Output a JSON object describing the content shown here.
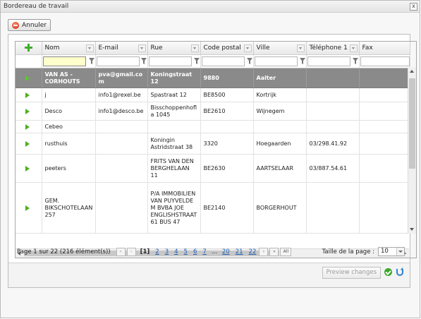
{
  "window": {
    "title": "Bordereau de travail",
    "close": "x"
  },
  "toolbar": {
    "cancel_label": "Annuler"
  },
  "grid": {
    "columns": [
      "Nom",
      "E-mail",
      "Rue",
      "Code postal",
      "Ville",
      "Téléphone 1",
      "Fax"
    ],
    "rows": [
      {
        "nom": "VAN AS - CORHOUTS",
        "email": "pva@gmail.com",
        "rue": "Koningstraat 12",
        "cp": "9880",
        "ville": "Aalter",
        "tel": "",
        "selected": true
      },
      {
        "nom": "j",
        "email": "info1@rexel.be",
        "rue": "Spastraat 12",
        "cp": "BE8500",
        "ville": "Kortrijk",
        "tel": ""
      },
      {
        "nom": "Desco",
        "email": "info1@desco.be",
        "rue": "Bisschoppenhofla 1045",
        "cp": "BE2610",
        "ville": "Wijnegem",
        "tel": ""
      },
      {
        "nom": "Cebeo",
        "email": "",
        "rue": "",
        "cp": "",
        "ville": "",
        "tel": ""
      },
      {
        "nom": "rusthuis",
        "email": "",
        "rue": "Koningin Astridstraat 38",
        "cp": "3320",
        "ville": "Hoegaarden",
        "tel": "03/298.41.92"
      },
      {
        "nom": "peeters",
        "email": "",
        "rue": "FRITS VAN DEN BERGHELAAN 11",
        "cp": "BE2630",
        "ville": "AARTSELAAR",
        "tel": "03/887.54.61"
      },
      {
        "nom": "GEM. BIKSCHOTELAAN 257",
        "email": "",
        "rue": "P/A IMMOBILIEN VAN PUYVELDE M BVBA JOE ENGLISHSTRAAT 61 BUS 47",
        "cp": "BE2140",
        "ville": "BORGERHOUT",
        "tel": ""
      }
    ]
  },
  "pager": {
    "info": "Page 1 sur 22 (216 élément(s))",
    "first": "«",
    "prev": "‹",
    "current": "[1]",
    "pages": [
      "2",
      "3",
      "4",
      "5",
      "6",
      "7"
    ],
    "ellipsis": "...",
    "tail_pages": [
      "20",
      "21",
      "22"
    ],
    "next": "›",
    "last": "»",
    "all": "All",
    "page_size_label": "Taille de la page :",
    "page_size_value": "10"
  },
  "footer": {
    "preview_label": "Preview changes"
  },
  "colors": {
    "selected_row": "#8a8a8a",
    "link": "#1f5fb4",
    "add_icon": "#3cae2a",
    "ok_icon": "#3aa82a",
    "cancel_icon": "#d21e05"
  }
}
